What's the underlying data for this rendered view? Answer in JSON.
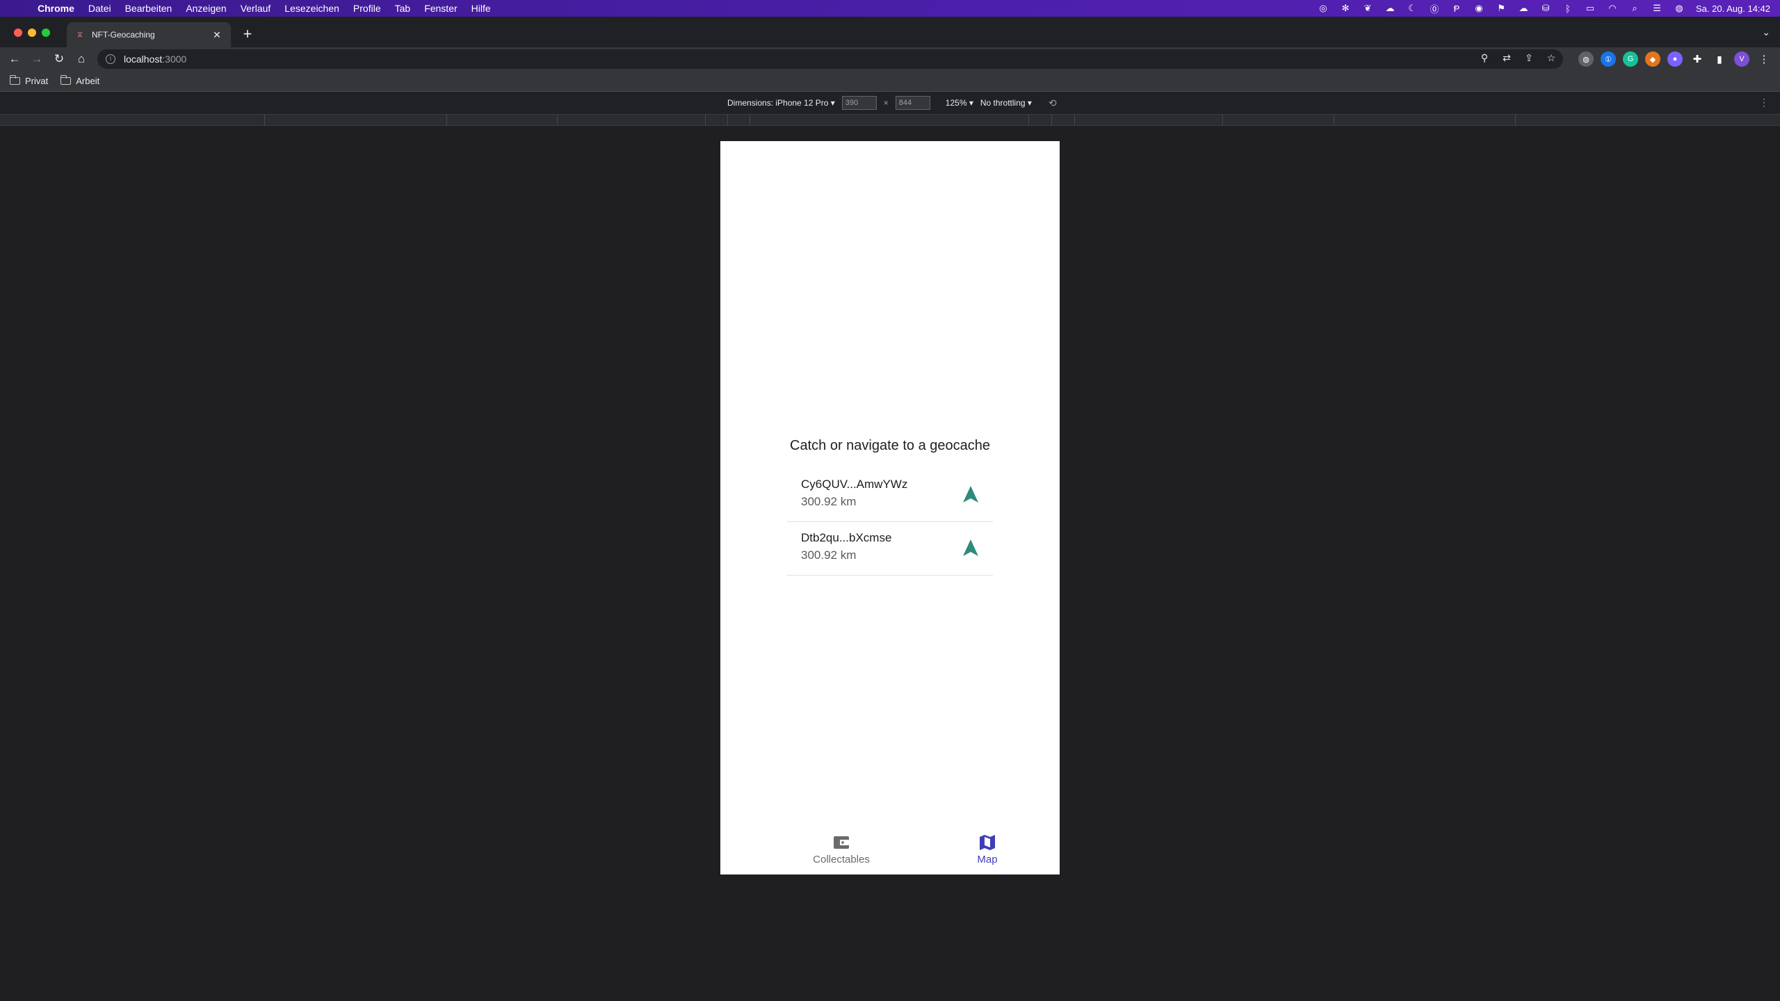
{
  "menubar": {
    "app": "Chrome",
    "items": [
      "Datei",
      "Bearbeiten",
      "Anzeigen",
      "Verlauf",
      "Lesezeichen",
      "Profile",
      "Tab",
      "Fenster",
      "Hilfe"
    ],
    "clock": "Sa. 20. Aug.  14:42"
  },
  "browser": {
    "tab_title": "NFT-Geocaching",
    "url_host": "localhost",
    "url_port": ":3000",
    "bookmarks": [
      "Privat",
      "Arbeit"
    ],
    "profile_initial": "V"
  },
  "devtools": {
    "dimensions_label": "Dimensions: iPhone 12 Pro ▾",
    "width": "390",
    "height": "844",
    "times": "×",
    "zoom": "125% ▾",
    "throttling": "No throttling ▾"
  },
  "app": {
    "heading": "Catch or navigate to a geocache",
    "geocaches": [
      {
        "name": "Cy6QUV...AmwYWz",
        "distance": "300.92 km"
      },
      {
        "name": "Dtb2qu...bXcmse",
        "distance": "300.92 km"
      }
    ],
    "tabs": {
      "collectables": "Collectables",
      "map": "Map"
    },
    "colors": {
      "navigate_arrow": "#2e8b7a",
      "active_tab": "#3f3fb5",
      "inactive_tab": "#6b6b6b"
    }
  }
}
